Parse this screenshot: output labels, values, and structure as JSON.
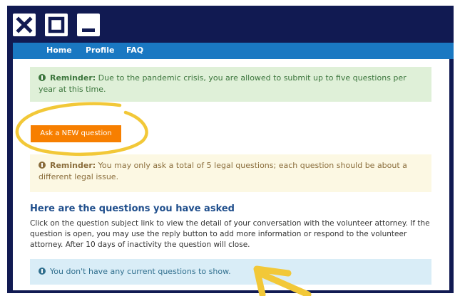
{
  "window": {
    "close_icon": "close-icon",
    "maximize_icon": "maximize-icon",
    "minimize_icon": "minimize-icon",
    "titlebar_color": "#111a52"
  },
  "nav": {
    "items": [
      {
        "label": "Home"
      },
      {
        "label": "Profile"
      },
      {
        "label": "FAQ"
      }
    ],
    "color": "#1a78c2"
  },
  "alerts": {
    "pandemic": {
      "label": "Reminder:",
      "text": " Due to the pandemic crisis, you are allowed to submit up to five questions per year at this time."
    },
    "limit": {
      "label": "Reminder:",
      "text": " You may only ask a total of 5 legal questions; each question should be about a different legal issue."
    },
    "empty": {
      "text": "You don't have any current questions to show."
    }
  },
  "actions": {
    "ask_button": "Ask a NEW question",
    "button_color": "#f77f00"
  },
  "questions": {
    "heading": "Here are the questions you have asked",
    "description": "Click on the question subject link to view the detail of your conversation with the volunteer attorney. If the question is open, you may use the reply button to add more information or respond to the volunteer attorney. After 10 days of inactivity the question will close."
  },
  "annotations": {
    "highlight_color": "#f2c838"
  }
}
